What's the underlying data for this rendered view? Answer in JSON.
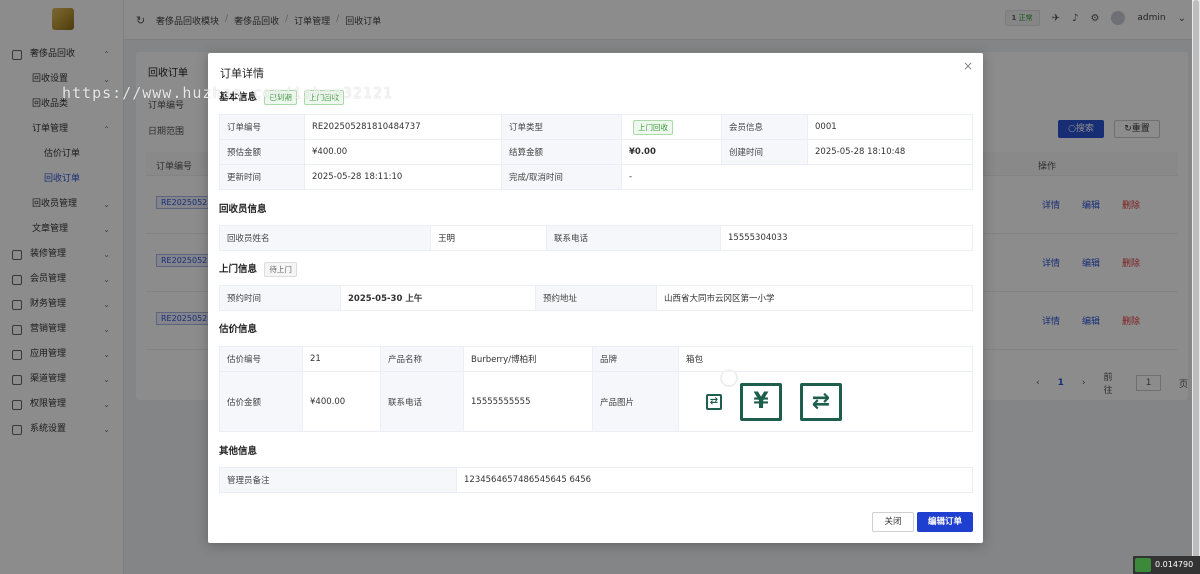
{
  "sidebar": {
    "items": [
      {
        "label": "奢侈品回收",
        "level": "top",
        "expanded": true
      },
      {
        "label": "回收设置",
        "level": "sub"
      },
      {
        "label": "回收品类",
        "level": "sub"
      },
      {
        "label": "订单管理",
        "level": "sub",
        "expanded": true
      },
      {
        "label": "估价订单",
        "level": "sub2"
      },
      {
        "label": "回收订单",
        "level": "sub2",
        "active": true
      },
      {
        "label": "回收员管理",
        "level": "sub"
      },
      {
        "label": "文章管理",
        "level": "sub"
      },
      {
        "label": "装修管理",
        "level": "top"
      },
      {
        "label": "会员管理",
        "level": "top"
      },
      {
        "label": "财务管理",
        "level": "top"
      },
      {
        "label": "营销管理",
        "level": "top"
      },
      {
        "label": "应用管理",
        "level": "top"
      },
      {
        "label": "渠道管理",
        "level": "top"
      },
      {
        "label": "权限管理",
        "level": "top"
      },
      {
        "label": "系统设置",
        "level": "top"
      }
    ]
  },
  "header": {
    "breadcrumb": [
      "奢侈品回收模块",
      "奢侈品回收",
      "订单管理",
      "回收订单"
    ],
    "env_num": "1",
    "env_label": "正常",
    "username": "admin"
  },
  "background": {
    "title": "回收订单",
    "filter_order_label": "订单编号",
    "filter_date_label": "日期范围",
    "search_label": "搜索",
    "reset_label": "重置",
    "col_order": "订单编号",
    "col_action": "操作",
    "order_prefix": "RE20250528",
    "act_detail": "详情",
    "act_edit": "编辑",
    "act_delete": "删除",
    "page_current": "1",
    "goto_label": "前往",
    "page_unit": "页",
    "goto_value": "1"
  },
  "watermark": "https://www.huzhan.com/ishop32121",
  "modal": {
    "title": "订单详情",
    "basic": {
      "heading": "基本信息",
      "tag1": "已到期",
      "tag2": "上门回收",
      "order_no_k": "订单编号",
      "order_no_v": "RE202505281810484737",
      "order_type_k": "订单类型",
      "order_type_v": "上门回收",
      "member_k": "会员信息",
      "member_v": "0001",
      "est_k": "预估金额",
      "est_v": "¥400.00",
      "settle_k": "结算金额",
      "settle_v": "¥0.00",
      "created_k": "创建时间",
      "created_v": "2025-05-28 18:10:48",
      "updated_k": "更新时间",
      "updated_v": "2025-05-28 18:11:10",
      "done_k": "完成/取消时间",
      "done_v": "-"
    },
    "recycler": {
      "heading": "回收员信息",
      "name_k": "回收员姓名",
      "name_v": "王明",
      "phone_k": "联系电话",
      "phone_v": "15555304033"
    },
    "visit": {
      "heading": "上门信息",
      "status": "待上门",
      "time_k": "预约时间",
      "time_v": "2025-05-30 上午",
      "addr_k": "预约地址",
      "addr_v": "山西省大同市云冈区第一小学"
    },
    "estimate": {
      "heading": "估价信息",
      "no_k": "估价编号",
      "no_v": "21",
      "product_k": "产品名称",
      "product_v": "Burberry/博柏利",
      "brand_k": "品牌",
      "brand_v": "箱包",
      "amount_k": "估价金额",
      "amount_v": "¥400.00",
      "phone_k": "联系电话",
      "phone_v": "15555555555",
      "image_k": "产品图片"
    },
    "other": {
      "heading": "其他信息",
      "remark_k": "管理员备注",
      "remark_v": "1234564657486545645 6456"
    },
    "close_label": "关闭",
    "edit_label": "编辑订单"
  },
  "corner_text": "0.014790"
}
